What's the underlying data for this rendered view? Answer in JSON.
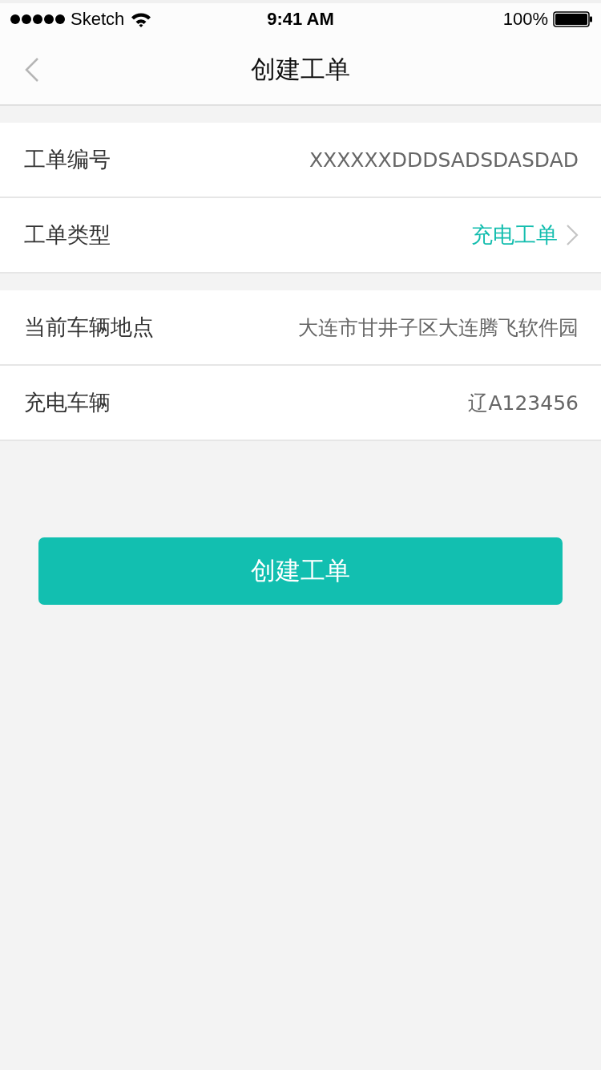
{
  "status_bar": {
    "carrier": "Sketch",
    "time": "9:41 AM",
    "battery": "100%"
  },
  "nav_bar": {
    "title": "创建工单"
  },
  "sections": [
    {
      "rows": [
        {
          "kind": "text",
          "label": "工单编号",
          "value": "XXXXXXDDDSADSDASDAD"
        },
        {
          "kind": "select",
          "label": "工单类型",
          "value": "充电工单"
        }
      ]
    },
    {
      "rows": [
        {
          "kind": "text",
          "label": "当前车辆地点",
          "value": "大连市甘井子区大连腾飞软件园"
        },
        {
          "kind": "text",
          "label": "充电车辆",
          "value": "辽A123456"
        }
      ]
    }
  ],
  "submit_button": "创建工单"
}
